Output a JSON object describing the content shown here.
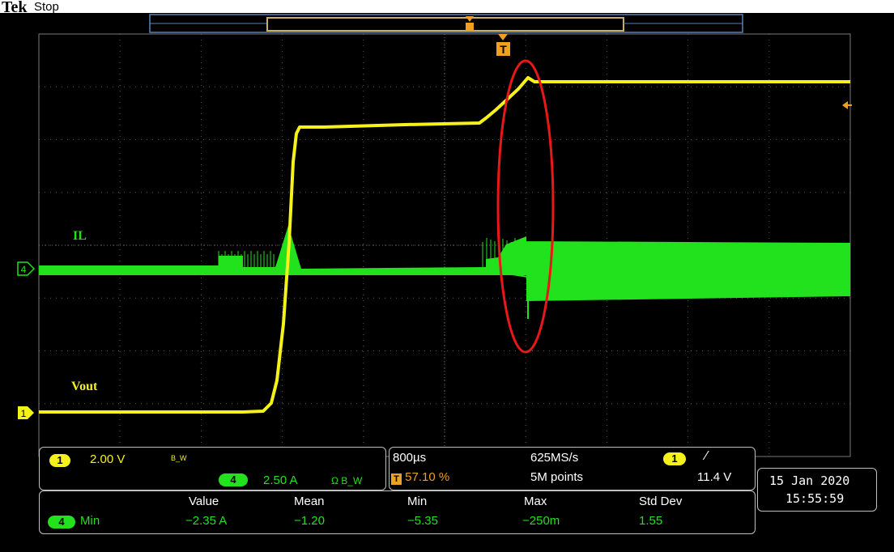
{
  "header": {
    "brand": "Tek",
    "status": "Stop"
  },
  "trace_labels": {
    "il": "IL",
    "vout": "Vout"
  },
  "markers": {
    "ch4": "4",
    "ch1": "1",
    "trigger": "T"
  },
  "channel_panel": {
    "ch1_badge": "1",
    "ch1_scale": "2.00 V",
    "ch1_bw": "B_W",
    "ch4_badge": "4",
    "ch4_scale": "2.50 A",
    "ch4_flags": "Ω B_W"
  },
  "timebase_panel": {
    "time_per_div": "800µs",
    "trigger_position": "57.10 %",
    "sample_rate": "625MS/s",
    "record_length": "5M points",
    "trig_badge": "1",
    "trig_slope": "⁄",
    "trig_level": "11.4 V"
  },
  "datetime": {
    "date": "15 Jan  2020",
    "time": "15:55:59"
  },
  "measurements": {
    "headers": [
      "Value",
      "Mean",
      "Min",
      "Max",
      "Std Dev"
    ],
    "row": {
      "channel": "4",
      "label": "Min",
      "values": [
        "−2.35 A",
        "−1.20",
        "−5.35",
        "−250m",
        "1.55"
      ]
    }
  },
  "colors": {
    "ch1": "#f5f21b",
    "ch4": "#21e21c",
    "trigger": "#f0a020",
    "annotation": "#e81818",
    "panel_border": "#bfbfbf"
  }
}
